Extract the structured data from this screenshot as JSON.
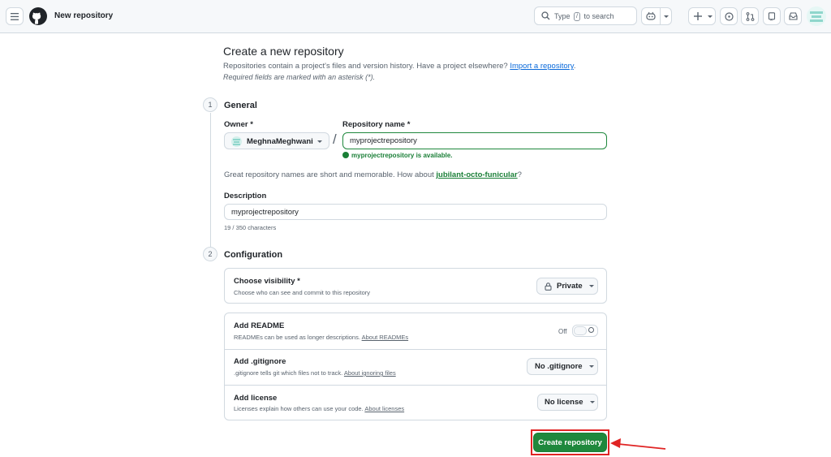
{
  "header": {
    "title": "New repository",
    "search": {
      "prefix": "Type",
      "key": "/",
      "suffix": "to search"
    }
  },
  "page": {
    "title": "Create a new repository",
    "lead_text": "Repositories contain a project's files and version history. Have a project elsewhere?",
    "import_link": "Import a repository",
    "lead_end": ".",
    "required_note": "Required fields are marked with an asterisk (*)."
  },
  "general": {
    "step": "1",
    "title": "General",
    "owner_label": "Owner *",
    "owner_value": "MeghnaMeghwani",
    "slash": "/",
    "repo_label": "Repository name *",
    "repo_value": "myprojectrepository",
    "available_msg": "myprojectrepository is available.",
    "suggestion_prefix": "Great repository names are short and memorable. How about",
    "suggestion_name": "jubilant-octo-funicular",
    "suggestion_suffix": "?",
    "description_label": "Description",
    "description_value": "myprojectrepository",
    "char_count": "19 / 350 characters"
  },
  "configuration": {
    "step": "2",
    "title": "Configuration",
    "visibility": {
      "title": "Choose visibility *",
      "desc": "Choose who can see and commit to this repository",
      "value": "Private"
    },
    "readme": {
      "title": "Add README",
      "desc": "READMEs can be used as longer descriptions.",
      "link": "About READMEs",
      "toggle_label": "Off"
    },
    "gitignore": {
      "title": "Add .gitignore",
      "desc": ".gitignore tells git which files not to track.",
      "link": "About ignoring files",
      "value": "No .gitignore"
    },
    "license": {
      "title": "Add license",
      "desc": "Licenses explain how others can use your code.",
      "link": "About licenses",
      "value": "No license"
    }
  },
  "create_button": "Create repository",
  "colors": {
    "primary_green": "#1f883d",
    "link_blue": "#0969da",
    "annotation_red": "#e02424"
  }
}
